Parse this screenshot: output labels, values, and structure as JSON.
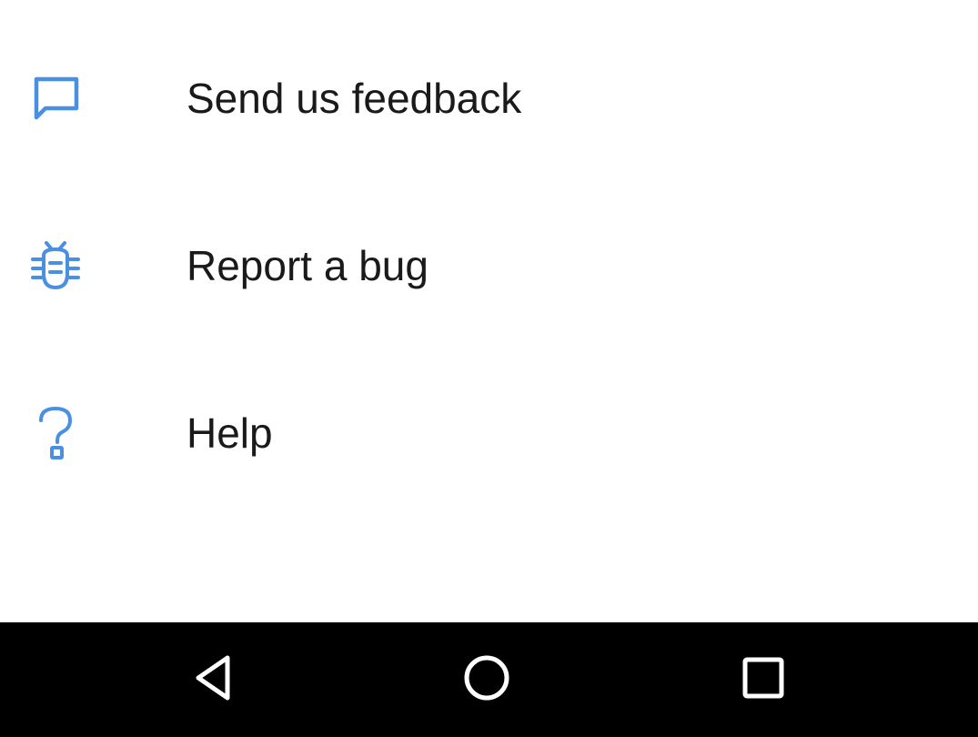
{
  "colors": {
    "accent": "#4a90e2",
    "text": "#1a1a1a",
    "background": "#ffffff",
    "navbar": "#000000",
    "navbar_icon": "#ffffff"
  },
  "menu": {
    "items": [
      {
        "label": "Send us feedback",
        "icon": "feedback-icon"
      },
      {
        "label": "Report a bug",
        "icon": "bug-icon"
      },
      {
        "label": "Help",
        "icon": "help-icon"
      }
    ]
  },
  "navbar": {
    "buttons": [
      {
        "icon": "back-icon"
      },
      {
        "icon": "home-icon"
      },
      {
        "icon": "recents-icon"
      }
    ]
  }
}
